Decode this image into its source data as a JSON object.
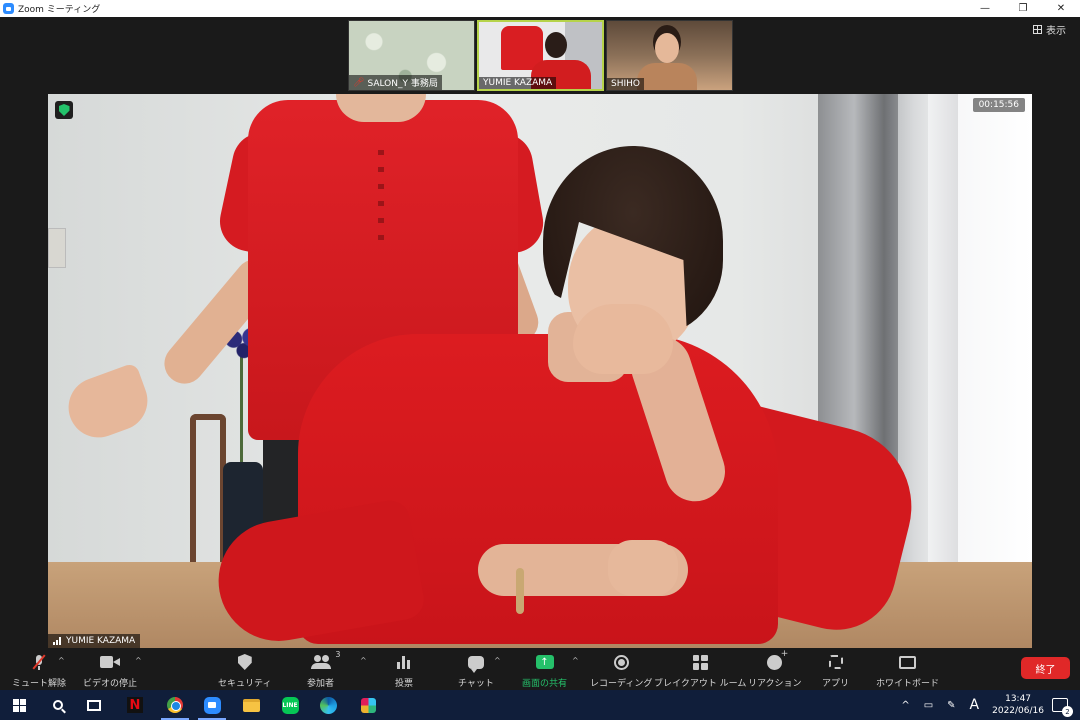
{
  "window": {
    "title": "Zoom ミーティング",
    "controls": {
      "minimize": "—",
      "restore": "❐",
      "close": "✕"
    }
  },
  "view_button": {
    "label": "表示",
    "icon": "grid-icon"
  },
  "thumbnails": [
    {
      "name": "SALON_Y 事務局",
      "muted": true
    },
    {
      "name": "YUMIE KAZAMA",
      "muted": false,
      "active": true
    },
    {
      "name": "SHIHO",
      "muted": false
    }
  ],
  "main_video": {
    "speaker": "YUMIE KAZAMA",
    "timer": "00:15:56",
    "encryption_icon": "green-shield-icon"
  },
  "toolbar": {
    "unmute": "ミュート解除",
    "stop_video": "ビデオの停止",
    "security": "セキュリティ",
    "participants": "参加者",
    "participants_count": "3",
    "polling": "投票",
    "chat": "チャット",
    "share_screen": "画面の共有",
    "recording": "レコーディング",
    "breakout_rooms": "ブレイクアウト ルーム",
    "reactions": "リアクション",
    "apps": "アプリ",
    "whiteboard": "ホワイトボード",
    "end": "終了",
    "caret": "^",
    "share_arrow": "↑"
  },
  "taskbar": {
    "apps": [
      "windows-start",
      "search",
      "task-view",
      "netflix",
      "chrome",
      "zoom",
      "file-explorer",
      "line",
      "edge",
      "slack"
    ],
    "line_label": "LINE",
    "netflix_label": "N",
    "tray_ime": "A",
    "tray_caret": "^",
    "time": "13:47",
    "date": "2022/06/16",
    "notifications": "2"
  },
  "colors": {
    "zoom_blue": "#2d8cff",
    "share_green": "#25c06a",
    "end_red": "#e02828",
    "active_border": "#b6d34a",
    "taskbar": "#101e3a"
  }
}
